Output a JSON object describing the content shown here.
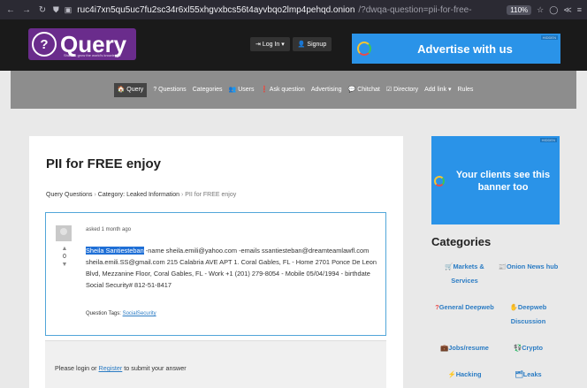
{
  "browser": {
    "url_host": "ruc4i7xn5qu5uc7fu2sc34r6xl55xhgvxbcs56t4ayvbqo2lmp4pehqd.onion",
    "url_path": "/?dwqa-question=pii-for-free-",
    "zoom": "110%"
  },
  "header": {
    "logo_text": "Query",
    "logo_mark": "?",
    "logo_tagline": "Share & grow the world's knowledge",
    "login_label": "Log In",
    "signup_label": "Signup",
    "ad_text": "Advertise with us",
    "ad_tag": "HIDDEN"
  },
  "nav": {
    "items": [
      {
        "label": "Query",
        "icon": "home-icon"
      },
      {
        "label": "Questions"
      },
      {
        "label": "Categories"
      },
      {
        "label": "Users"
      },
      {
        "label": "Ask question"
      },
      {
        "label": "Advertising"
      },
      {
        "label": "Chitchat"
      },
      {
        "label": "Directory"
      },
      {
        "label": "Add link"
      },
      {
        "label": "Rules"
      }
    ]
  },
  "question": {
    "title": "PII for FREE enjoy",
    "breadcrumb": {
      "root": "Query Questions",
      "category": "Category: Leaked Information",
      "current": "PII for FREE enjoy"
    },
    "asked": "asked 1 month ago",
    "votes": "0",
    "highlight": "Sheila Santiesteban",
    "body_rest": " -name sheila.emili@yahoo.com -emails ssantiesteban@dreamteamlawfl.com sheila.emili.SS@gmail.com 215 Calabria AVE APT 1. Coral Gables, FL - Home 2701 Ponce De Leon Blvd, Mezzanine Floor, Coral Gables, FL - Work +1 (201) 279-8054 - Mobile 05/04/1994 - birthdate Social Security# 812-51-8417",
    "tags_label": "Question Tags:",
    "tag": "SocialSecurity"
  },
  "answer": {
    "prefix": "Please login or ",
    "register": "Register",
    "suffix": " to submit your answer"
  },
  "sidebar": {
    "ad_tag": "HIDDEN",
    "ad_text": "Your clients see this banner too",
    "categories_title": "Categories",
    "categories": [
      {
        "label": "Markets & Services"
      },
      {
        "label": "Onion News hub"
      },
      {
        "label": "General Deepweb"
      },
      {
        "label": "Deepweb Discussion"
      },
      {
        "label": "Jobs/resume"
      },
      {
        "label": "Crypto"
      },
      {
        "label": "Hacking"
      },
      {
        "label": "Leaks"
      }
    ]
  },
  "colors": {
    "accent_blue": "#2a93e8",
    "highlight_blue": "#1f6fd6",
    "logo_purple": "#6a2c8c",
    "link_blue": "#2b7cc4"
  }
}
